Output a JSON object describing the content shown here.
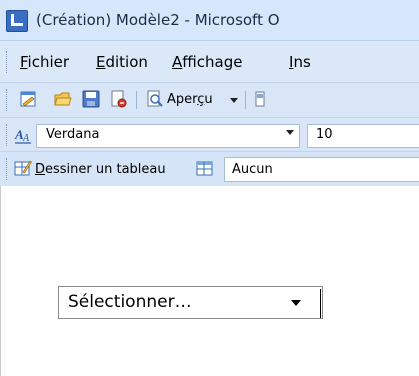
{
  "window": {
    "title": "(Création) Modèle2 - Microsoft O",
    "app_icon": "access-app-icon"
  },
  "menu": {
    "items": [
      {
        "accel": "F",
        "rest": "ichier"
      },
      {
        "accel": "E",
        "rest": "dition"
      },
      {
        "accel": "A",
        "rest": "ffichage"
      },
      {
        "accel": "I",
        "rest": "ns"
      }
    ]
  },
  "toolbar_standard": {
    "icons": [
      "design-view-icon",
      "open-folder-icon",
      "save-icon",
      "print-icon",
      "print-preview-icon",
      "overflow-icon"
    ],
    "preview_label_pre": "Aper",
    "preview_label_accel": "ç",
    "preview_label_post": "u"
  },
  "toolbar_format": {
    "font_icon": "font-format-icon",
    "font_name": "Verdana",
    "font_size": "10"
  },
  "toolbar_table": {
    "draw_table_accel": "D",
    "draw_table_rest": "essiner un tableau",
    "style_value": "Aucun"
  },
  "form": {
    "select_value": "Sélectionner…"
  },
  "colors": {
    "toolbar_bg": "#d8e6f7",
    "titlebar_bg": "#d6e6fb"
  }
}
